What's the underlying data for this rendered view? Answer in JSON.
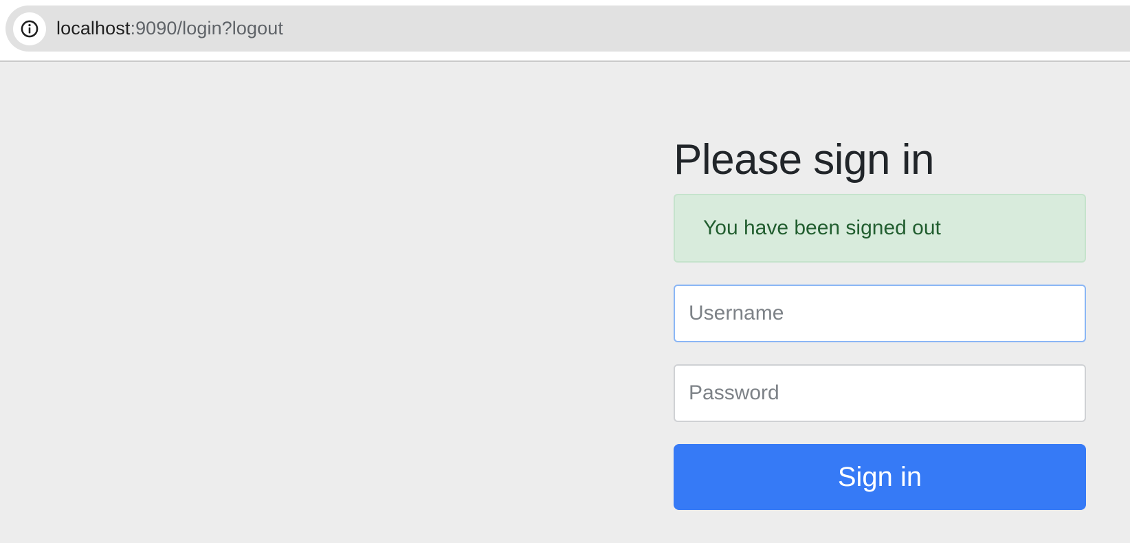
{
  "browser": {
    "url_host": "localhost",
    "url_path": ":9090/login?logout",
    "site_info_icon": "info-icon"
  },
  "login": {
    "title": "Please sign in",
    "alert": "You have been signed out",
    "username": {
      "value": "",
      "placeholder": "Username"
    },
    "password": {
      "value": "",
      "placeholder": "Password"
    },
    "submit_label": "Sign in"
  },
  "colors": {
    "page_background": "#ededed",
    "address_bar": "#e1e1e1",
    "alert_background": "#d8ebdc",
    "alert_text": "#225e30",
    "focused_input_border": "#8ab6f5",
    "primary_button": "#367af6"
  }
}
